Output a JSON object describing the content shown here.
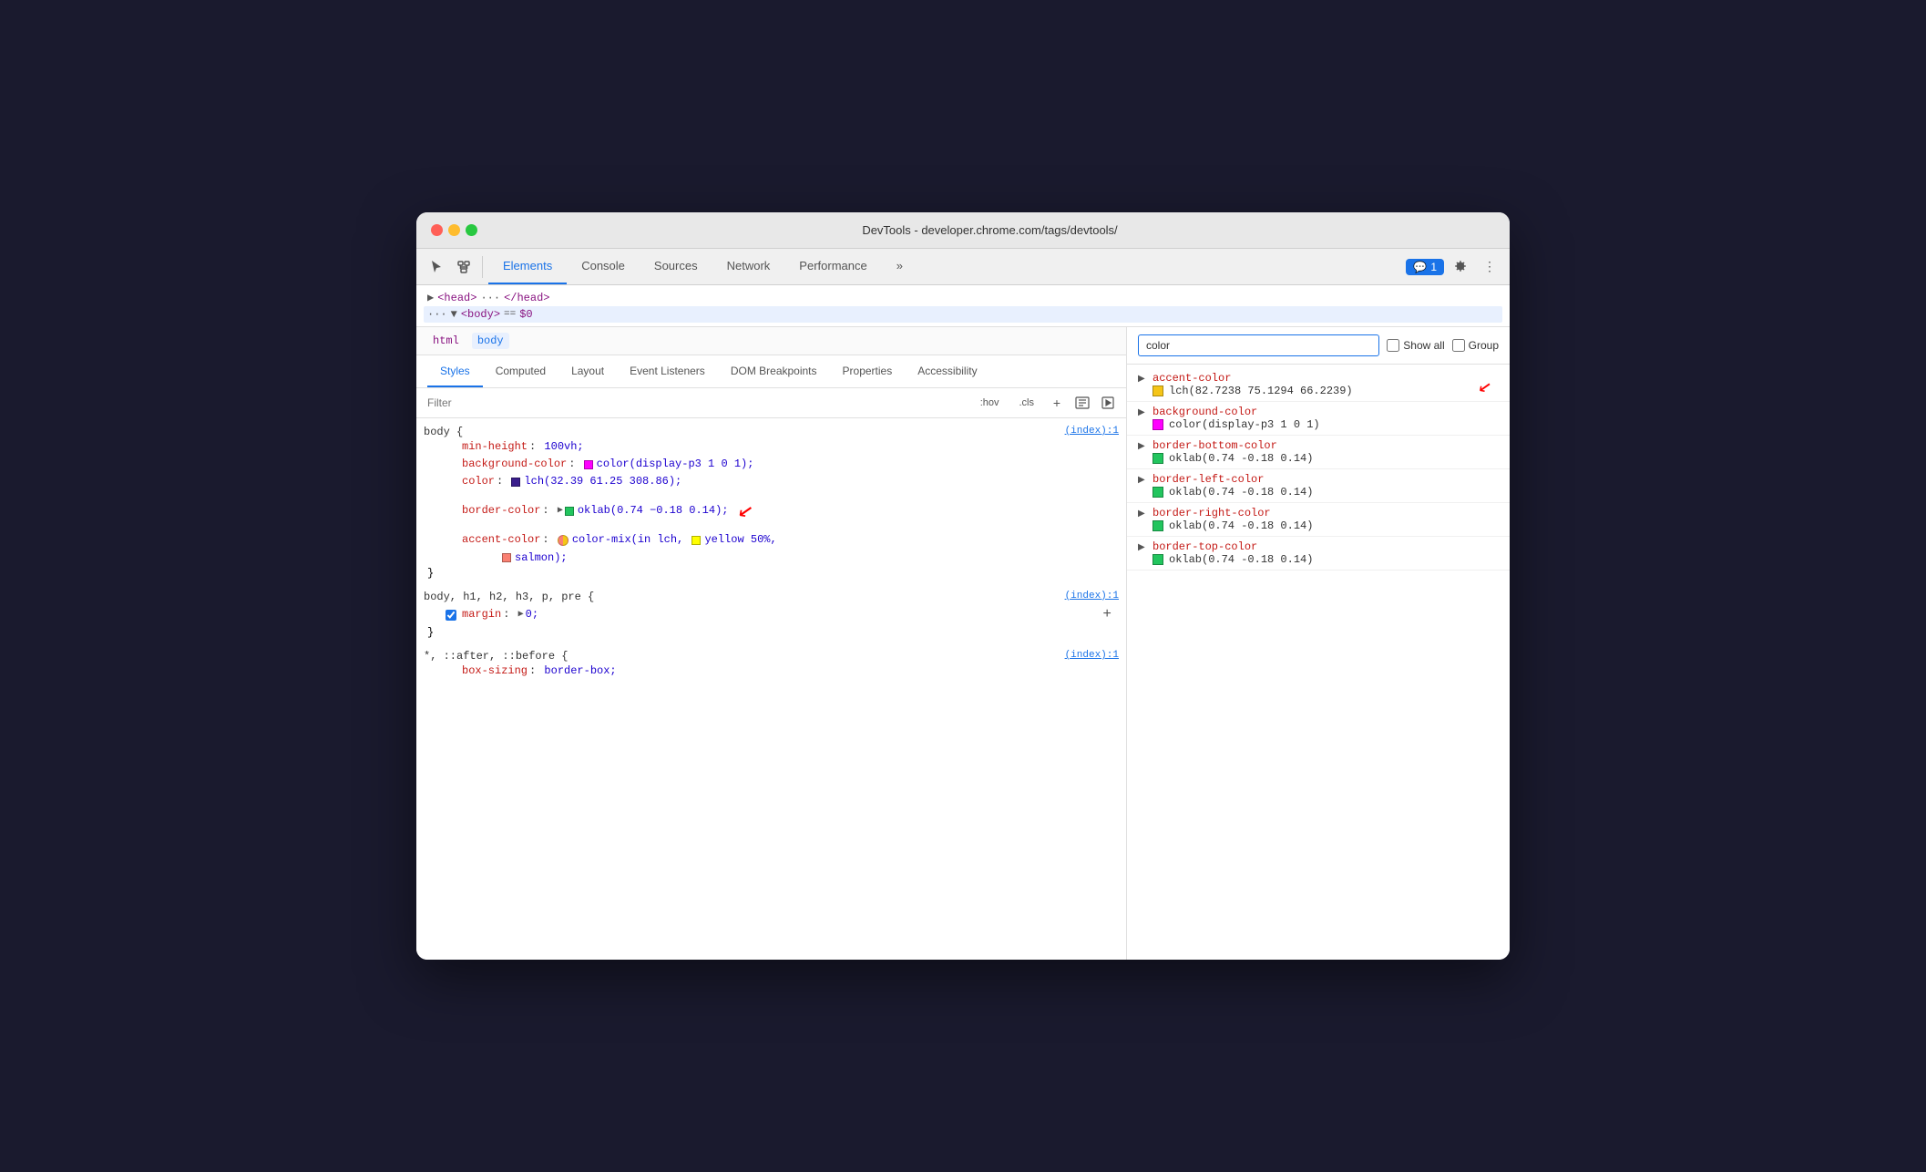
{
  "window": {
    "title": "DevTools - developer.chrome.com/tags/devtools/"
  },
  "toolbar": {
    "tabs": [
      {
        "id": "elements",
        "label": "Elements",
        "active": true
      },
      {
        "id": "console",
        "label": "Console",
        "active": false
      },
      {
        "id": "sources",
        "label": "Sources",
        "active": false
      },
      {
        "id": "network",
        "label": "Network",
        "active": false
      },
      {
        "id": "performance",
        "label": "Performance",
        "active": false
      },
      {
        "id": "more",
        "label": "»",
        "active": false
      }
    ],
    "chat_badge": "💬 1"
  },
  "dom": {
    "head_row": "▶ <head> ··· </head>",
    "body_row": "··· ▼ <body> == $0"
  },
  "breadcrumb": {
    "items": [
      {
        "label": "html",
        "active": false
      },
      {
        "label": "body",
        "active": true
      }
    ]
  },
  "sub_tabs": [
    {
      "label": "Styles",
      "active": true
    },
    {
      "label": "Computed",
      "active": false
    },
    {
      "label": "Layout",
      "active": false
    },
    {
      "label": "Event Listeners",
      "active": false
    },
    {
      "label": "DOM Breakpoints",
      "active": false
    },
    {
      "label": "Properties",
      "active": false
    },
    {
      "label": "Accessibility",
      "active": false
    }
  ],
  "filter": {
    "placeholder": "Filter",
    "hov_label": ":hov",
    "cls_label": ".cls"
  },
  "css_rules": [
    {
      "selector": "body {",
      "source": "(index):1",
      "properties": [
        {
          "name": "min-height",
          "value": "100vh;",
          "swatch": null,
          "checkbox": false,
          "triangle": false
        },
        {
          "name": "background-color",
          "value": "color(display-p3 1 0 1);",
          "swatch": "#ff00ff",
          "checkbox": false,
          "triangle": false
        },
        {
          "name": "color",
          "value": "lch(32.39 61.25 308.86);",
          "swatch": "#3a1e8c",
          "checkbox": false,
          "triangle": false
        },
        {
          "name": "border-color",
          "value": "oklab(0.74 −0.18 0.14);",
          "swatch": "#22c55e",
          "checkbox": false,
          "triangle": true
        },
        {
          "name": "accent-color",
          "value": "color-mix(in lch,",
          "swatch": null,
          "checkbox": false,
          "triangle": false,
          "extra": "yellow 50%, salmon);",
          "colormix": true
        }
      ],
      "close": "}"
    },
    {
      "selector": "body, h1, h2, h3, p, pre {",
      "source": "(index):1",
      "properties": [
        {
          "name": "margin",
          "value": "▶ 0;",
          "swatch": null,
          "checkbox": true,
          "triangle": false
        }
      ],
      "close": "}"
    },
    {
      "selector": "*, ::after, ::before {",
      "source": "(index):1",
      "properties": [
        {
          "name": "box-sizing",
          "value": "border-box;",
          "swatch": null,
          "checkbox": false,
          "triangle": false
        }
      ]
    }
  ],
  "computed": {
    "search_placeholder": "color",
    "show_all_label": "Show all",
    "group_label": "Group",
    "items": [
      {
        "name": "accent-color",
        "value": "lch(82.7238 75.1294 66.2239)",
        "swatch": "#f5c518",
        "expandable": true
      },
      {
        "name": "background-color",
        "value": "color(display-p3 1 0 1)",
        "swatch": "#ff00ff",
        "expandable": true
      },
      {
        "name": "border-bottom-color",
        "value": "oklab(0.74 -0.18 0.14)",
        "swatch": "#22c55e",
        "expandable": true
      },
      {
        "name": "border-left-color",
        "value": "oklab(0.74 -0.18 0.14)",
        "swatch": "#22c55e",
        "expandable": true
      },
      {
        "name": "border-right-color",
        "value": "oklab(0.74 -0.18 0.14)",
        "swatch": "#22c55e",
        "expandable": true
      },
      {
        "name": "border-top-color",
        "value": "oklab(0.74 -0.18 0.14)",
        "swatch": "#22c55e",
        "expandable": true
      }
    ]
  }
}
